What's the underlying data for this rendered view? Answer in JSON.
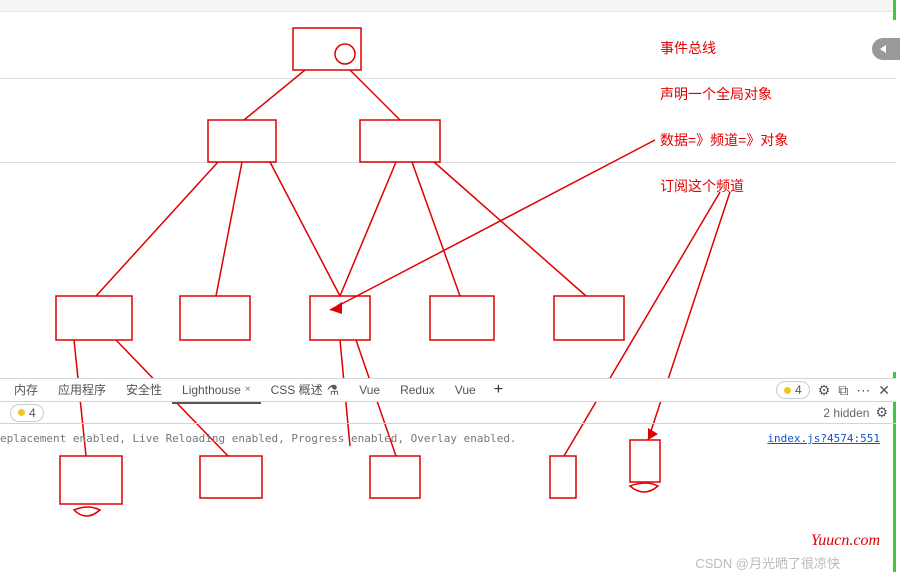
{
  "annotations": {
    "line1": "事件总线",
    "line2": "声明一个全局对象",
    "line3": "数据=》频道=》对象",
    "line4": "订阅这个频道"
  },
  "devtools": {
    "tabs": {
      "memory": "内存",
      "application": "应用程序",
      "security": "安全性",
      "lighthouse": "Lighthouse",
      "css_overview": "CSS 概述",
      "vue1": "Vue",
      "redux": "Redux",
      "vue2": "Vue"
    },
    "warning_count": "4",
    "hidden_text": "2 hidden"
  },
  "log": {
    "message": "eplacement enabled, Live Reloading enabled, Progress enabled, Overlay enabled.",
    "link": "index.js?4574:551"
  },
  "watermark": {
    "brand": "Yuucn.com",
    "csdn": "CSDN @月光晒了很凉快"
  }
}
